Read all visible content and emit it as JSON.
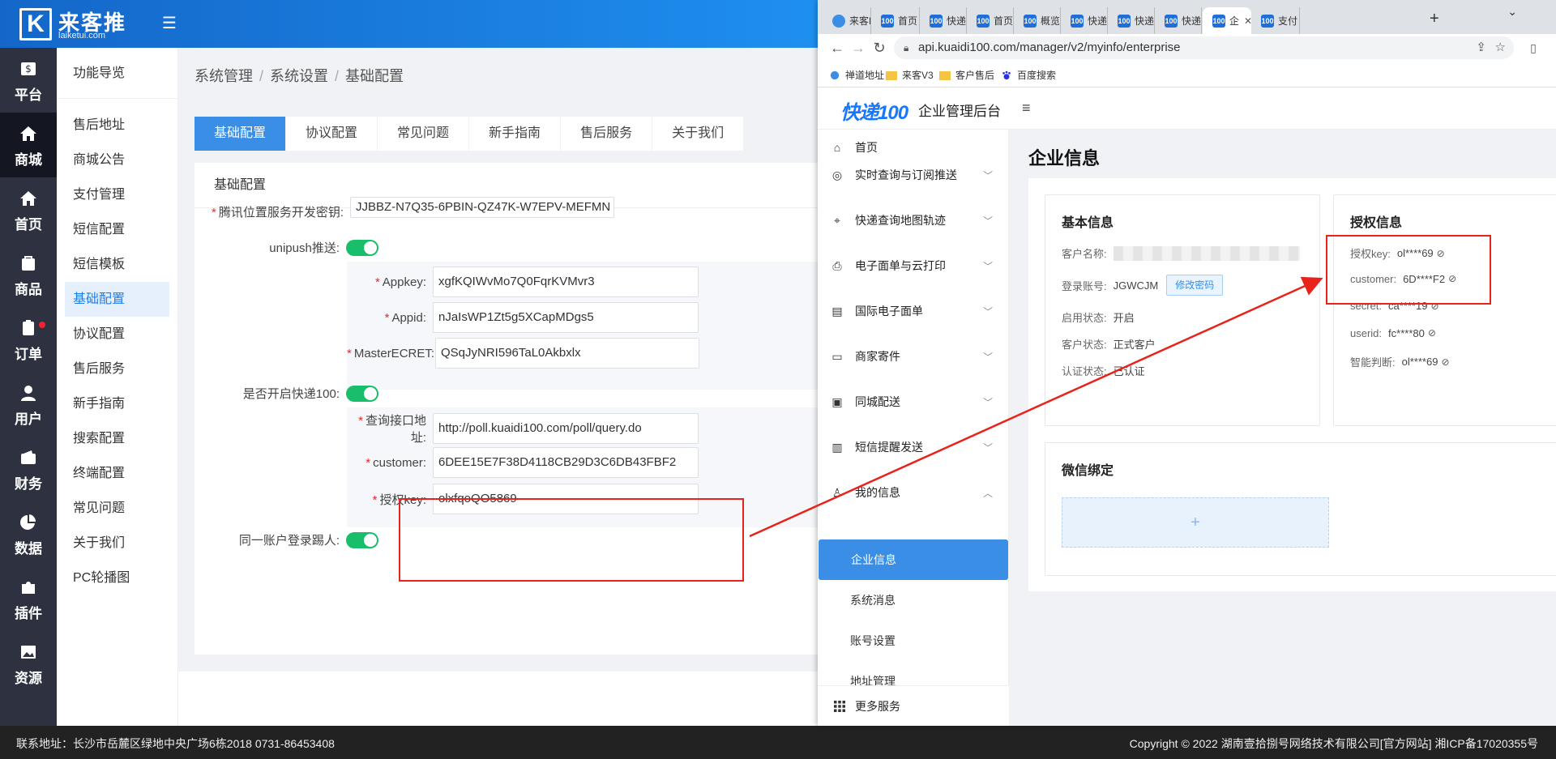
{
  "admin": {
    "logo_cn": "来客推",
    "logo_en": "laiketui.com",
    "icon_nav": [
      {
        "label": "平台",
        "icon": "dollar-icon"
      },
      {
        "label": "商城",
        "icon": "home-icon",
        "active": true
      },
      {
        "label": "首页",
        "icon": "home-icon"
      },
      {
        "label": "商品",
        "icon": "bag-icon"
      },
      {
        "label": "订单",
        "icon": "clipboard-icon",
        "dot": true
      },
      {
        "label": "用户",
        "icon": "user-icon"
      },
      {
        "label": "财务",
        "icon": "wallet-icon"
      },
      {
        "label": "数据",
        "icon": "pie-chart-icon"
      },
      {
        "label": "插件",
        "icon": "puzzle-icon"
      },
      {
        "label": "资源",
        "icon": "image-icon"
      }
    ],
    "sub_nav": {
      "head": "功能导览",
      "items": [
        "售后地址",
        "商城公告",
        "支付管理",
        "短信配置",
        "短信模板",
        "基础配置",
        "协议配置",
        "售后服务",
        "新手指南",
        "搜索配置",
        "终端配置",
        "常见问题",
        "关于我们",
        "PC轮播图"
      ],
      "active_index": 5
    },
    "breadcrumb": [
      "系统管理",
      "系统设置",
      "基础配置"
    ],
    "tabs": [
      "基础配置",
      "协议配置",
      "常见问题",
      "新手指南",
      "售后服务",
      "关于我们"
    ],
    "panel_title": "基础配置",
    "form": {
      "tencent_label": "腾讯位置服务开发密钥:",
      "tencent_value": "JJBBZ-N7Q35-6PBIN-QZ47K-W7EPV-MEFMN",
      "unipush_label": "unipush推送:",
      "appkey_label": "Appkey:",
      "appkey_value": "xgfKQIWvMo7Q0FqrKVMvr3",
      "appid_label": "Appid:",
      "appid_value": "nJaIsWP1Zt5g5XCapMDgs5",
      "master_label": "MasterECRET:",
      "master_value": "QSqJyNRI596TaL0Akbxlx",
      "kd100_label": "是否开启快递100:",
      "query_label": "查询接口地址:",
      "query_value": "http://poll.kuaidi100.com/poll/query.do",
      "customer_label": "customer:",
      "customer_value": "6DEE15E7F38D4118CB29D3C6DB43FBF2",
      "authkey_label": "授权key:",
      "authkey_value": "olxfqoQO5869",
      "kick_label": "同一账户登录踢人:"
    },
    "footer_left": "联系地址：长沙市岳麓区绿地中央广场6栋2018 0731-86453408",
    "footer_right": "Copyright © 2022 湖南壹拾捌号网络技术有限公司[官方网站]   湘ICP备17020355号"
  },
  "browser": {
    "tabs": [
      {
        "title": "来客P",
        "fav": "q"
      },
      {
        "title": "首页 -",
        "fav": "100"
      },
      {
        "title": "快递1",
        "fav": "100"
      },
      {
        "title": "首页 -",
        "fav": "100"
      },
      {
        "title": "概览 -",
        "fav": "100"
      },
      {
        "title": "快递1",
        "fav": "100"
      },
      {
        "title": "快递1",
        "fav": "100"
      },
      {
        "title": "快递1",
        "fav": "100"
      },
      {
        "title": "企",
        "fav": "100",
        "active": true
      },
      {
        "title": "支付",
        "fav": "100"
      }
    ],
    "url": "api.kuaidi100.com/manager/v2/myinfo/enterprise",
    "bookmarks": [
      "禅道地址",
      "来客V3",
      "客户售后",
      "百度搜索"
    ]
  },
  "kd": {
    "logo": "快递100",
    "title": "企业管理后台",
    "menu": [
      {
        "label": "首页",
        "icon": "home-icon"
      },
      {
        "label": "实时查询与订阅推送",
        "icon": "location-icon",
        "chev": "down"
      },
      {
        "label": "快递查询地图轨迹",
        "icon": "map-pin-icon",
        "chev": "down"
      },
      {
        "label": "电子面单与云打印",
        "icon": "printer-icon",
        "chev": "down"
      },
      {
        "label": "国际电子面单",
        "icon": "document-icon",
        "chev": "down"
      },
      {
        "label": "商家寄件",
        "icon": "box-icon",
        "chev": "down"
      },
      {
        "label": "同城配送",
        "icon": "bag-icon",
        "chev": "down"
      },
      {
        "label": "短信提醒发送",
        "icon": "message-icon",
        "chev": "down"
      },
      {
        "label": "我的信息",
        "icon": "user-icon",
        "chev": "up"
      }
    ],
    "submenu": [
      "企业信息",
      "系统消息",
      "账号设置",
      "地址管理"
    ],
    "more": "更多服务",
    "page_title": "企业信息",
    "basic": {
      "title": "基本信息",
      "name_label": "客户名称:",
      "account_label": "登录账号:",
      "account_value": "JGWCJM",
      "modify_btn": "修改密码",
      "enable_label": "启用状态:",
      "enable_value": "开启",
      "cust_state_label": "客户状态:",
      "cust_state_value": "正式客户",
      "cert_label": "认证状态:",
      "cert_value": "已认证"
    },
    "auth": {
      "title": "授权信息",
      "rows": [
        {
          "label": "授权key:",
          "value": "ol****69"
        },
        {
          "label": "customer:",
          "value": "6D****F2"
        },
        {
          "label": "secret:",
          "value": "ca****19"
        },
        {
          "label": "userid:",
          "value": "fc****80"
        },
        {
          "label": "智能判断:",
          "value": "ol****69"
        }
      ]
    },
    "wechat": {
      "title": "微信绑定",
      "add": "+"
    }
  },
  "colors": {
    "accent": "#3a8ee6",
    "annotation": "#e8231b",
    "toggle_on": "#19be6b"
  }
}
